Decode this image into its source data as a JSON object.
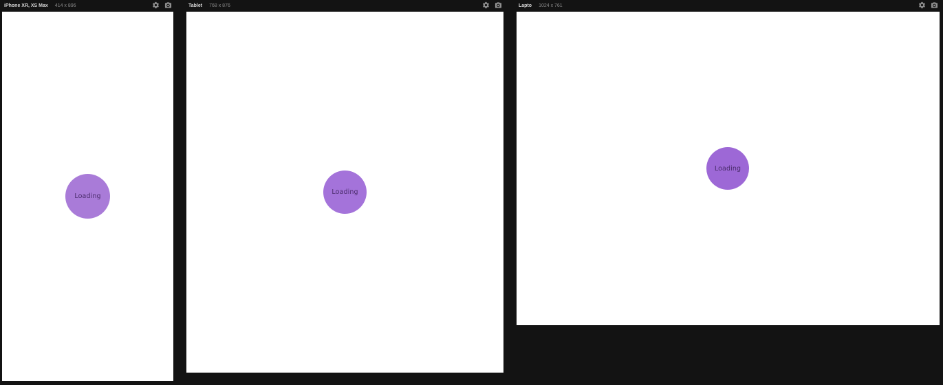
{
  "devices": [
    {
      "name": "iPhone XR, XS Max",
      "size": "414 x 896",
      "loader_text": "Loading"
    },
    {
      "name": "Tablet",
      "size": "768 x 876",
      "loader_text": "Loading"
    },
    {
      "name": "Lapto",
      "size": "1024 x 761",
      "loader_text": "Loading"
    }
  ],
  "icons": {
    "settings": "gear-icon",
    "screenshot": "camera-icon"
  },
  "colors": {
    "background": "#131313",
    "viewport": "#ffffff",
    "loader": "#a56fd6",
    "loader_text": "#4a2c6b"
  }
}
